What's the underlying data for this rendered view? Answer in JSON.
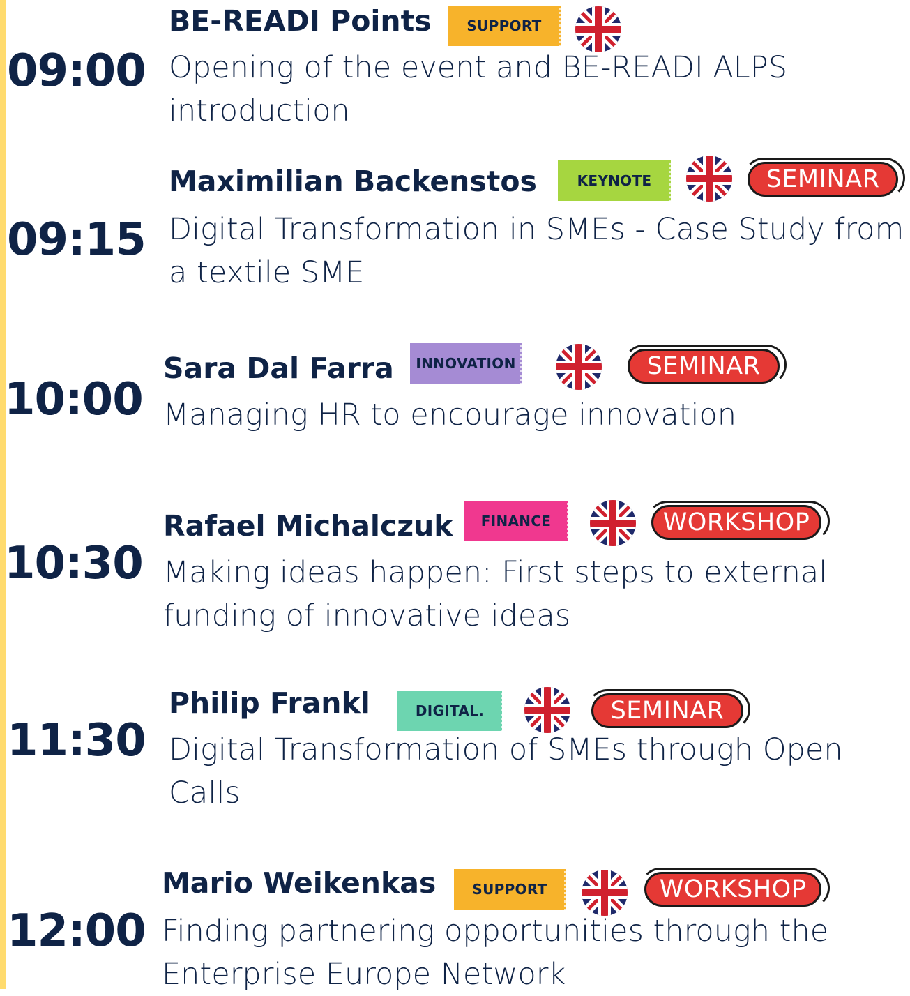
{
  "sessions": [
    {
      "time": "09:00",
      "speaker": "BE-READI  Points",
      "tag": "SUPPORT",
      "tag_color": "#f7b32b",
      "format": "",
      "title": "Opening of the event and BE-READI ALPS introduction",
      "language_icon": "uk-flag-icon"
    },
    {
      "time": "09:15",
      "speaker": "Maximilian Backenstos",
      "tag": "KEYNOTE",
      "tag_color": "#a6d640",
      "format": "SEMINAR",
      "title": "Digital Transformation in SMEs - Case Study from a textile SME",
      "language_icon": "uk-flag-icon"
    },
    {
      "time": "10:00",
      "speaker": "Sara Dal Farra",
      "tag": "INNOVATION",
      "tag_color": "#a58bd4",
      "format": "SEMINAR",
      "title": "Managing HR to encourage innovation",
      "language_icon": "uk-flag-icon"
    },
    {
      "time": "10:30",
      "speaker": "Rafael Michalczuk",
      "tag": "FINANCE",
      "tag_color": "#f0388f",
      "format": "WORKSHOP",
      "title": "Making ideas happen: First steps to external funding of innovative ideas",
      "language_icon": "uk-flag-icon"
    },
    {
      "time": "11:30",
      "speaker": "Philip Frankl",
      "tag": "DIGITAL.",
      "tag_color": "#6dd5b0",
      "format": "SEMINAR",
      "title": "Digital Transformation of SMEs through Open Calls",
      "language_icon": "uk-flag-icon"
    },
    {
      "time": "12:00",
      "speaker": "Mario Weikenkas",
      "tag": "SUPPORT",
      "tag_color": "#f7b32b",
      "format": "WORKSHOP",
      "title": "Finding partnering opportunities through the Enterprise Europe Network",
      "language_icon": "uk-flag-icon"
    }
  ],
  "colors": {
    "text": "#0f2346",
    "accent_bar": "#ffdb6e",
    "pill": "#e53935",
    "flag_blue": "#1f2a6b",
    "flag_red": "#d0202e"
  }
}
